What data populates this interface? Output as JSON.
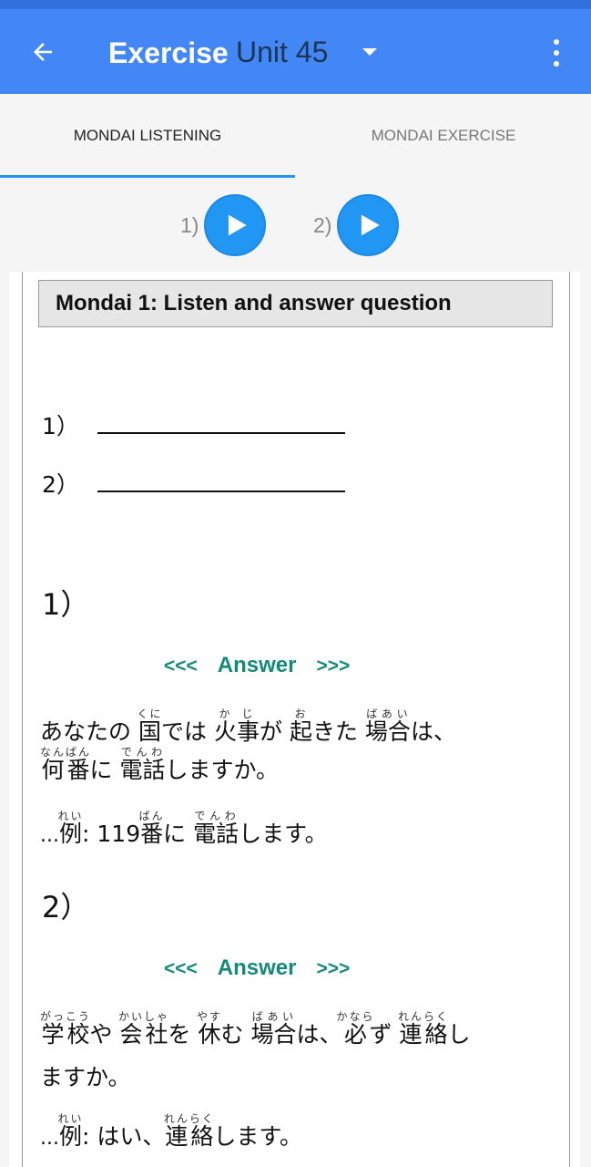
{
  "appbar": {
    "title": "Exercise",
    "unit": "Unit 45"
  },
  "tabs": [
    {
      "label": "MONDAI LISTENING"
    },
    {
      "label": "MONDAI EXERCISE"
    }
  ],
  "players": [
    {
      "label": "1)"
    },
    {
      "label": "2)"
    }
  ],
  "content": {
    "heading": "Mondai 1: Listen and answer question",
    "blanks": [
      "1）",
      "2）"
    ],
    "questions": [
      {
        "number": "1）",
        "answer_label": "Answer",
        "answer_left": "<<<",
        "answer_right": ">>>",
        "q_line1": {
          "t1": "あなたの",
          "r1b": "国",
          "r1t": "くに",
          "t2": "では",
          "r2b": "火事",
          "r2t": "かじ",
          "t3": "が",
          "r3b": "起",
          "r3t": "お",
          "t4": "きた",
          "r4b": "場合",
          "r4t": "ばあい",
          "t5": "は、"
        },
        "q_line2": {
          "r1b": "何番",
          "r1t": "なんばん",
          "t1": "に",
          "r2b": "電話",
          "r2t": "でんわ",
          "t2": "しますか。"
        },
        "ex_line": {
          "prefix": "...",
          "r1b": "例",
          "r1t": "れい",
          "t1": ":",
          "t2": "119",
          "r2b": "番",
          "r2t": "ばん",
          "t3": "に",
          "r3b": "電話",
          "r3t": "でんわ",
          "t4": "します。"
        }
      },
      {
        "number": "2）",
        "answer_label": "Answer",
        "answer_left": "<<<",
        "answer_right": ">>>",
        "q_line1": {
          "r1b": "学校",
          "r1t": "がっこう",
          "t1": "や",
          "r2b": "会社",
          "r2t": "かいしゃ",
          "t2": "を",
          "r3b": "休",
          "r3t": "やす",
          "t3": "む",
          "r4b": "場合",
          "r4t": "ばあい",
          "t4": "は、",
          "r5b": "必",
          "r5t": "かなら",
          "t5": "ず",
          "r6b": "連絡",
          "r6t": "れんらく",
          "t6": "し"
        },
        "q_line2": {
          "t1": "ますか。"
        },
        "ex_line": {
          "prefix": "...",
          "r1b": "例",
          "r1t": "れい",
          "t1": ":",
          "t2": "はい、",
          "r2b": "連絡",
          "r2t": "れんらく",
          "t3": "します。"
        }
      }
    ]
  },
  "colors": {
    "primary": "#4287f5",
    "accent": "#2196f3",
    "answer": "#138a7a"
  },
  "icons": {
    "back": "arrow-left-icon",
    "dropdown": "dropdown-arrow-icon",
    "more": "more-vertical-icon",
    "play": "play-icon"
  }
}
